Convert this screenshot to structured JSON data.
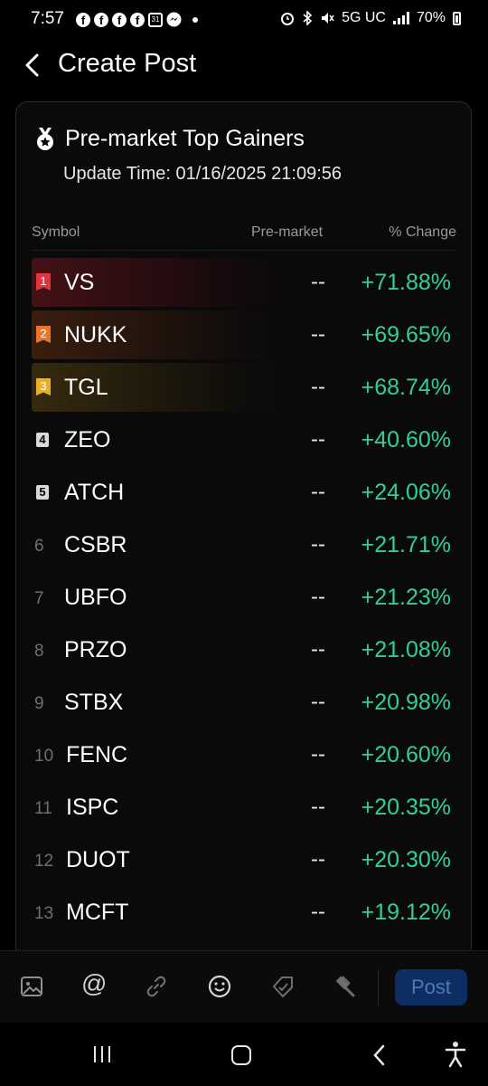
{
  "status_bar": {
    "time": "7:57",
    "calendar_day": "31",
    "network": "5G UC",
    "battery": "70%",
    "left_icons": [
      "facebook-icon",
      "facebook-icon",
      "facebook-icon",
      "facebook-icon",
      "calendar-icon",
      "messenger-icon"
    ],
    "right_icons": [
      "alarm-icon",
      "bluetooth-icon",
      "mute-icon",
      "signal-icon",
      "battery-icon"
    ]
  },
  "header": {
    "title": "Create Post"
  },
  "card": {
    "title": "Pre-market Top Gainers",
    "update_time": "Update Time: 01/16/2025 21:09:56",
    "columns": {
      "symbol": "Symbol",
      "premarket": "Pre-market",
      "change": "% Change"
    },
    "rows": [
      {
        "rank": "1",
        "symbol": "VS",
        "premarket": "--",
        "change": "+71.88%"
      },
      {
        "rank": "2",
        "symbol": "NUKK",
        "premarket": "--",
        "change": "+69.65%"
      },
      {
        "rank": "3",
        "symbol": "TGL",
        "premarket": "--",
        "change": "+68.74%"
      },
      {
        "rank": "4",
        "symbol": "ZEO",
        "premarket": "--",
        "change": "+40.60%"
      },
      {
        "rank": "5",
        "symbol": "ATCH",
        "premarket": "--",
        "change": "+24.06%"
      },
      {
        "rank": "6",
        "symbol": "CSBR",
        "premarket": "--",
        "change": "+21.71%"
      },
      {
        "rank": "7",
        "symbol": "UBFO",
        "premarket": "--",
        "change": "+21.23%"
      },
      {
        "rank": "8",
        "symbol": "PRZO",
        "premarket": "--",
        "change": "+21.08%"
      },
      {
        "rank": "9",
        "symbol": "STBX",
        "premarket": "--",
        "change": "+20.98%"
      },
      {
        "rank": "10",
        "symbol": "FENC",
        "premarket": "--",
        "change": "+20.60%"
      },
      {
        "rank": "11",
        "symbol": "ISPC",
        "premarket": "--",
        "change": "+20.35%"
      },
      {
        "rank": "12",
        "symbol": "DUOT",
        "premarket": "--",
        "change": "+20.30%"
      },
      {
        "rank": "13",
        "symbol": "MCFT",
        "premarket": "--",
        "change": "+19.12%"
      }
    ]
  },
  "toolbar": {
    "mention_label": "@",
    "post_label": "Post",
    "icons": [
      "image-icon",
      "mention-icon",
      "link-icon",
      "emoji-icon",
      "tag-icon",
      "gavel-icon"
    ]
  },
  "colors": {
    "gain": "#2fd09a",
    "rank1": "#e0353f",
    "rank2": "#e8752a",
    "rank3": "#e6b02a",
    "post_button": "#0e2e63"
  }
}
